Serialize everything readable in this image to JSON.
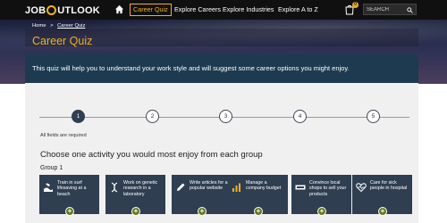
{
  "header": {
    "logo_text_left": "JOB",
    "logo_text_right": "UTLOOK",
    "nav": [
      "Career Quiz",
      "Explore Careers",
      "Explore Industries",
      "Explore A to Z"
    ],
    "cart_count": "0",
    "search_placeholder": "SEARCH"
  },
  "breadcrumb": {
    "home": "Home",
    "separator": ">",
    "current": "Career Quiz"
  },
  "page": {
    "title": "Career Quiz",
    "intro": "This quiz will help you to understand your work style and will suggest some career options you might enjoy."
  },
  "steps": [
    "1",
    "2",
    "3",
    "4",
    "5"
  ],
  "required_note": "All fields are required",
  "question": "Choose one activity you would most enjoy from each group",
  "group_title": "Group 1",
  "activities": [
    {
      "label": "Train in surf lifesaving at a beach",
      "icon": "surfboard-icon"
    },
    {
      "label": "Work on genetic research in a laboratory",
      "icon": "dna-icon"
    },
    {
      "label": "Write articles for a popular website",
      "icon": "pencil-icon"
    },
    {
      "label": "Manage a company budget",
      "icon": "bar-chart-icon"
    },
    {
      "label": "Convince local shops to sell your products",
      "icon": "sale-tag-icon"
    },
    {
      "label": "Care for sick people in hospital",
      "icon": "heart-pulse-icon"
    }
  ],
  "colors": {
    "accent": "#f2b01e",
    "card": "#2f3e51",
    "intro_bar": "#1d3a50",
    "add_button": "#5f7a1e"
  }
}
